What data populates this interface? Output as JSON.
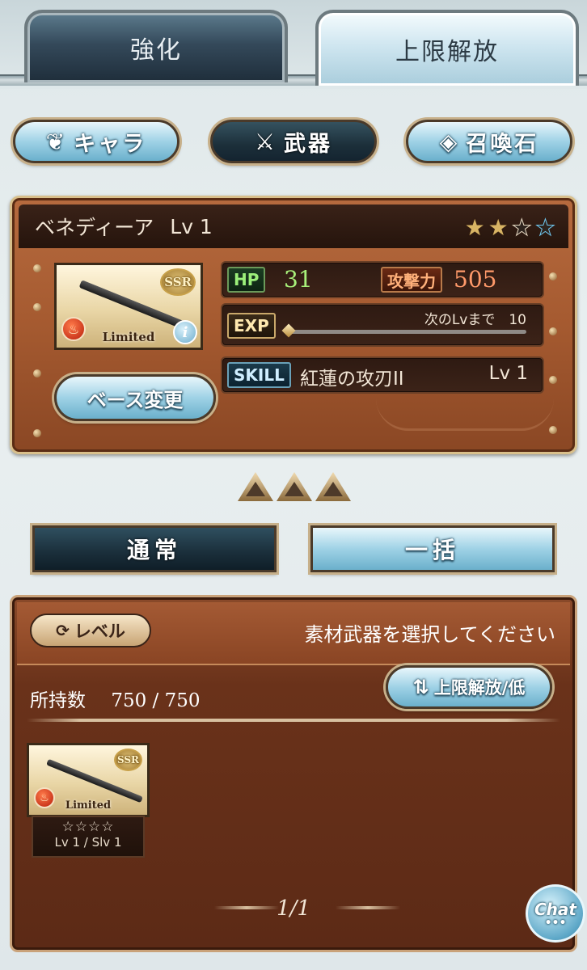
{
  "tabs": {
    "enhance": "強化",
    "uncap": "上限解放"
  },
  "categories": {
    "character": "キャラ",
    "weapon": "武器",
    "summon": "召喚石"
  },
  "weapon": {
    "name": "ベネディーア",
    "level": "Lv 1",
    "rarity_badge": "SSR",
    "badge": "Limited",
    "info_glyph": "i",
    "uncap_stars_filled": 2,
    "uncap_stars_total": 4,
    "hp_label": "HP",
    "hp": "31",
    "atk_label": "攻撃力",
    "atk": "505",
    "exp_label": "EXP",
    "exp_next": "次のLvまで　10",
    "exp_progress": 0.0,
    "skill_label": "SKILL",
    "skill_name": "紅蓮の攻刃II",
    "skill_level": "Lv 1",
    "base_change": "ベース変更"
  },
  "modes": {
    "normal": "通常",
    "bulk": "一括"
  },
  "materials": {
    "sort_level": "レベル",
    "prompt": "素材武器を選択してください",
    "owned_label": "所持数",
    "owned_count": "750 / 750",
    "filter_button": "上限解放/低",
    "items": [
      {
        "rarity": "SSR",
        "badge": "Limited",
        "stars": "☆☆☆☆",
        "level": "Lv 1 / Slv 1"
      }
    ],
    "page": "1/1"
  },
  "chat": {
    "label": "Chat",
    "dots": "•••"
  },
  "icons": {
    "character": "crest-icon",
    "weapon": "crossed-swords-icon",
    "summon": "crystal-icon",
    "refresh": "refresh-icon",
    "sort": "up-down-arrows-icon"
  },
  "colors": {
    "hp": "#9cf07a",
    "atk": "#ff9a6a",
    "panel": "#a55a30",
    "accent_blue": "#9fd2e6"
  }
}
